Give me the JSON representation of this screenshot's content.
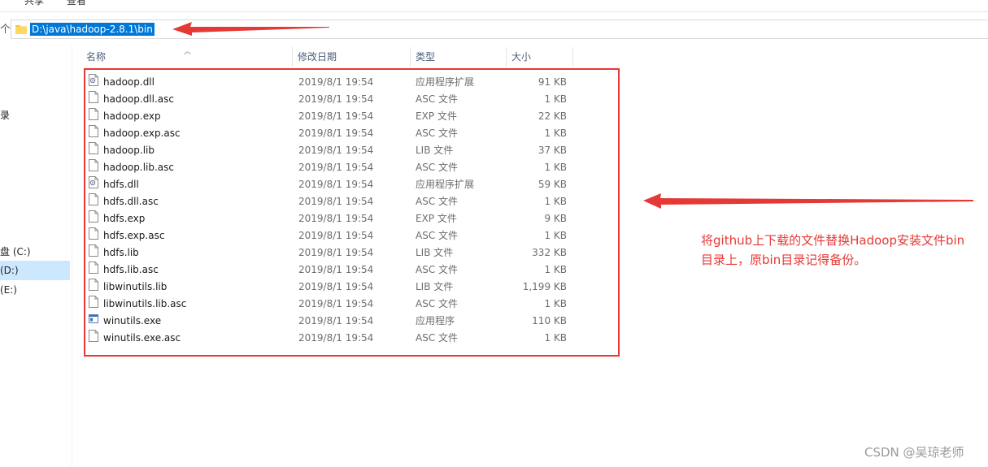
{
  "ribbon": {
    "tabs": [
      "共享",
      "查看"
    ]
  },
  "address_bar": {
    "path": "D:\\java\\hadoop-2.8.1\\bin"
  },
  "sidebar": {
    "items": [
      "盘 (C:)",
      "(D:)",
      "(E:)"
    ]
  },
  "columns": {
    "name": "名称",
    "date": "修改日期",
    "type": "类型",
    "size": "大小"
  },
  "files": [
    {
      "name": "hadoop.dll",
      "date": "2019/8/1 19:54",
      "type": "应用程序扩展",
      "size": "91 KB",
      "icon": "dll-icon"
    },
    {
      "name": "hadoop.dll.asc",
      "date": "2019/8/1 19:54",
      "type": "ASC 文件",
      "size": "1 KB",
      "icon": "file-icon"
    },
    {
      "name": "hadoop.exp",
      "date": "2019/8/1 19:54",
      "type": "EXP 文件",
      "size": "22 KB",
      "icon": "file-icon"
    },
    {
      "name": "hadoop.exp.asc",
      "date": "2019/8/1 19:54",
      "type": "ASC 文件",
      "size": "1 KB",
      "icon": "file-icon"
    },
    {
      "name": "hadoop.lib",
      "date": "2019/8/1 19:54",
      "type": "LIB 文件",
      "size": "37 KB",
      "icon": "file-icon"
    },
    {
      "name": "hadoop.lib.asc",
      "date": "2019/8/1 19:54",
      "type": "ASC 文件",
      "size": "1 KB",
      "icon": "file-icon"
    },
    {
      "name": "hdfs.dll",
      "date": "2019/8/1 19:54",
      "type": "应用程序扩展",
      "size": "59 KB",
      "icon": "dll-icon"
    },
    {
      "name": "hdfs.dll.asc",
      "date": "2019/8/1 19:54",
      "type": "ASC 文件",
      "size": "1 KB",
      "icon": "file-icon"
    },
    {
      "name": "hdfs.exp",
      "date": "2019/8/1 19:54",
      "type": "EXP 文件",
      "size": "9 KB",
      "icon": "file-icon"
    },
    {
      "name": "hdfs.exp.asc",
      "date": "2019/8/1 19:54",
      "type": "ASC 文件",
      "size": "1 KB",
      "icon": "file-icon"
    },
    {
      "name": "hdfs.lib",
      "date": "2019/8/1 19:54",
      "type": "LIB 文件",
      "size": "332 KB",
      "icon": "file-icon"
    },
    {
      "name": "hdfs.lib.asc",
      "date": "2019/8/1 19:54",
      "type": "ASC 文件",
      "size": "1 KB",
      "icon": "file-icon"
    },
    {
      "name": "libwinutils.lib",
      "date": "2019/8/1 19:54",
      "type": "LIB 文件",
      "size": "1,199 KB",
      "icon": "file-icon"
    },
    {
      "name": "libwinutils.lib.asc",
      "date": "2019/8/1 19:54",
      "type": "ASC 文件",
      "size": "1 KB",
      "icon": "file-icon"
    },
    {
      "name": "winutils.exe",
      "date": "2019/8/1 19:54",
      "type": "应用程序",
      "size": "110 KB",
      "icon": "exe-icon"
    },
    {
      "name": "winutils.exe.asc",
      "date": "2019/8/1 19:54",
      "type": "ASC 文件",
      "size": "1 KB",
      "icon": "file-icon"
    }
  ],
  "annotation": {
    "lines": [
      "将github上下载的文件替换Hadoop安装文件bin",
      "目录上，原bin目录记得备份。"
    ],
    "color": "#e53935"
  },
  "watermark": "CSDN @吴琼老师"
}
